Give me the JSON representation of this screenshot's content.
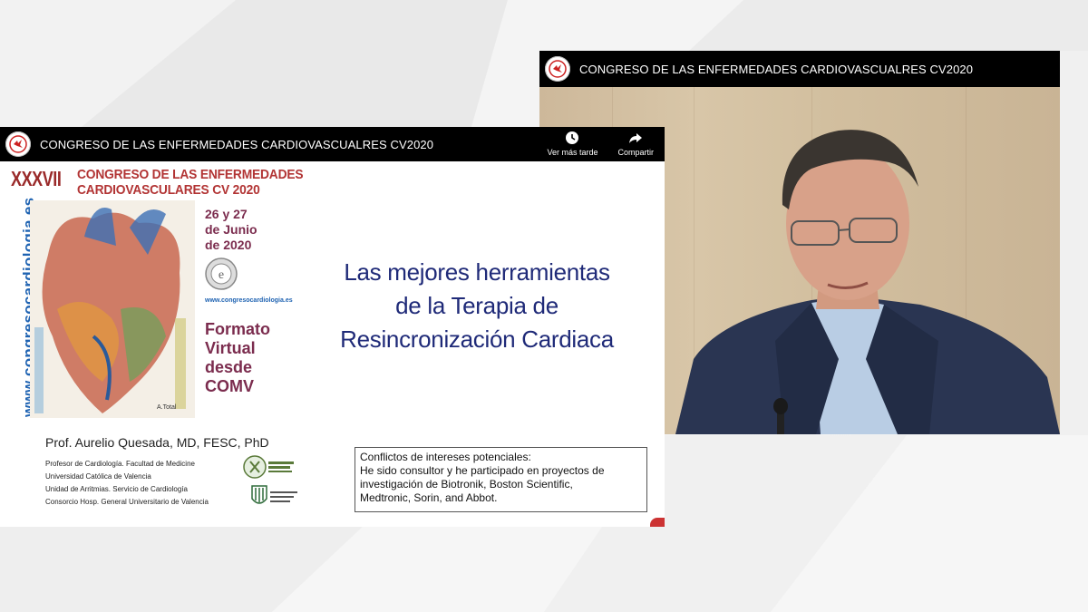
{
  "right_player": {
    "channel_title": "CONGRESO DE LAS ENFERMEDADES CARDIOVASCUALRES CV2020"
  },
  "left_player": {
    "channel_title": "CONGRESO DE LAS ENFERMEDADES CARDIOVASCUALRES CV2020",
    "actions": [
      {
        "label": "Ver más tarde",
        "icon": "clock-icon"
      },
      {
        "label": "Compartir",
        "icon": "share-icon"
      }
    ]
  },
  "slide": {
    "congress_number": "XXXVII",
    "congress_name_line1": "CONGRESO DE LAS ENFERMEDADES",
    "congress_name_line2": "CARDIOVASCULARES CV 2020",
    "website_vertical": "www.congresocardiologia.es",
    "website_small": "www.congresocardiologia.es",
    "dates": [
      "26 y 27",
      "de Junio",
      "de 2020"
    ],
    "format_lines": [
      "Formato",
      "Virtual",
      "desde",
      "COMV"
    ],
    "title_lines": [
      "Las mejores herramientas",
      "de la Terapia de",
      "Resincronización Cardiaca"
    ],
    "speaker": "Prof. Aurelio Quesada, MD, FESC, PhD",
    "affiliations": [
      "Profesor de  Cardiología. Facultad de Medicine",
      "Universidad Católica de Valencia",
      "Unidad de Arritmias. Servicio de Cardiología",
      "Consorcio Hosp. General Universitario de Valencia"
    ],
    "conflicts": [
      "Conflictos de intereses potenciales:",
      "He sido consultor y he participado en proyectos de",
      "investigación de Biotronik, Boston Scientific,",
      "Medtronic, Sorin, and Abbot."
    ]
  },
  "colors": {
    "congress_red": "#b23434",
    "date_purple": "#7b2c4e",
    "title_navy": "#1f2a78",
    "link_blue": "#1f63b2"
  }
}
